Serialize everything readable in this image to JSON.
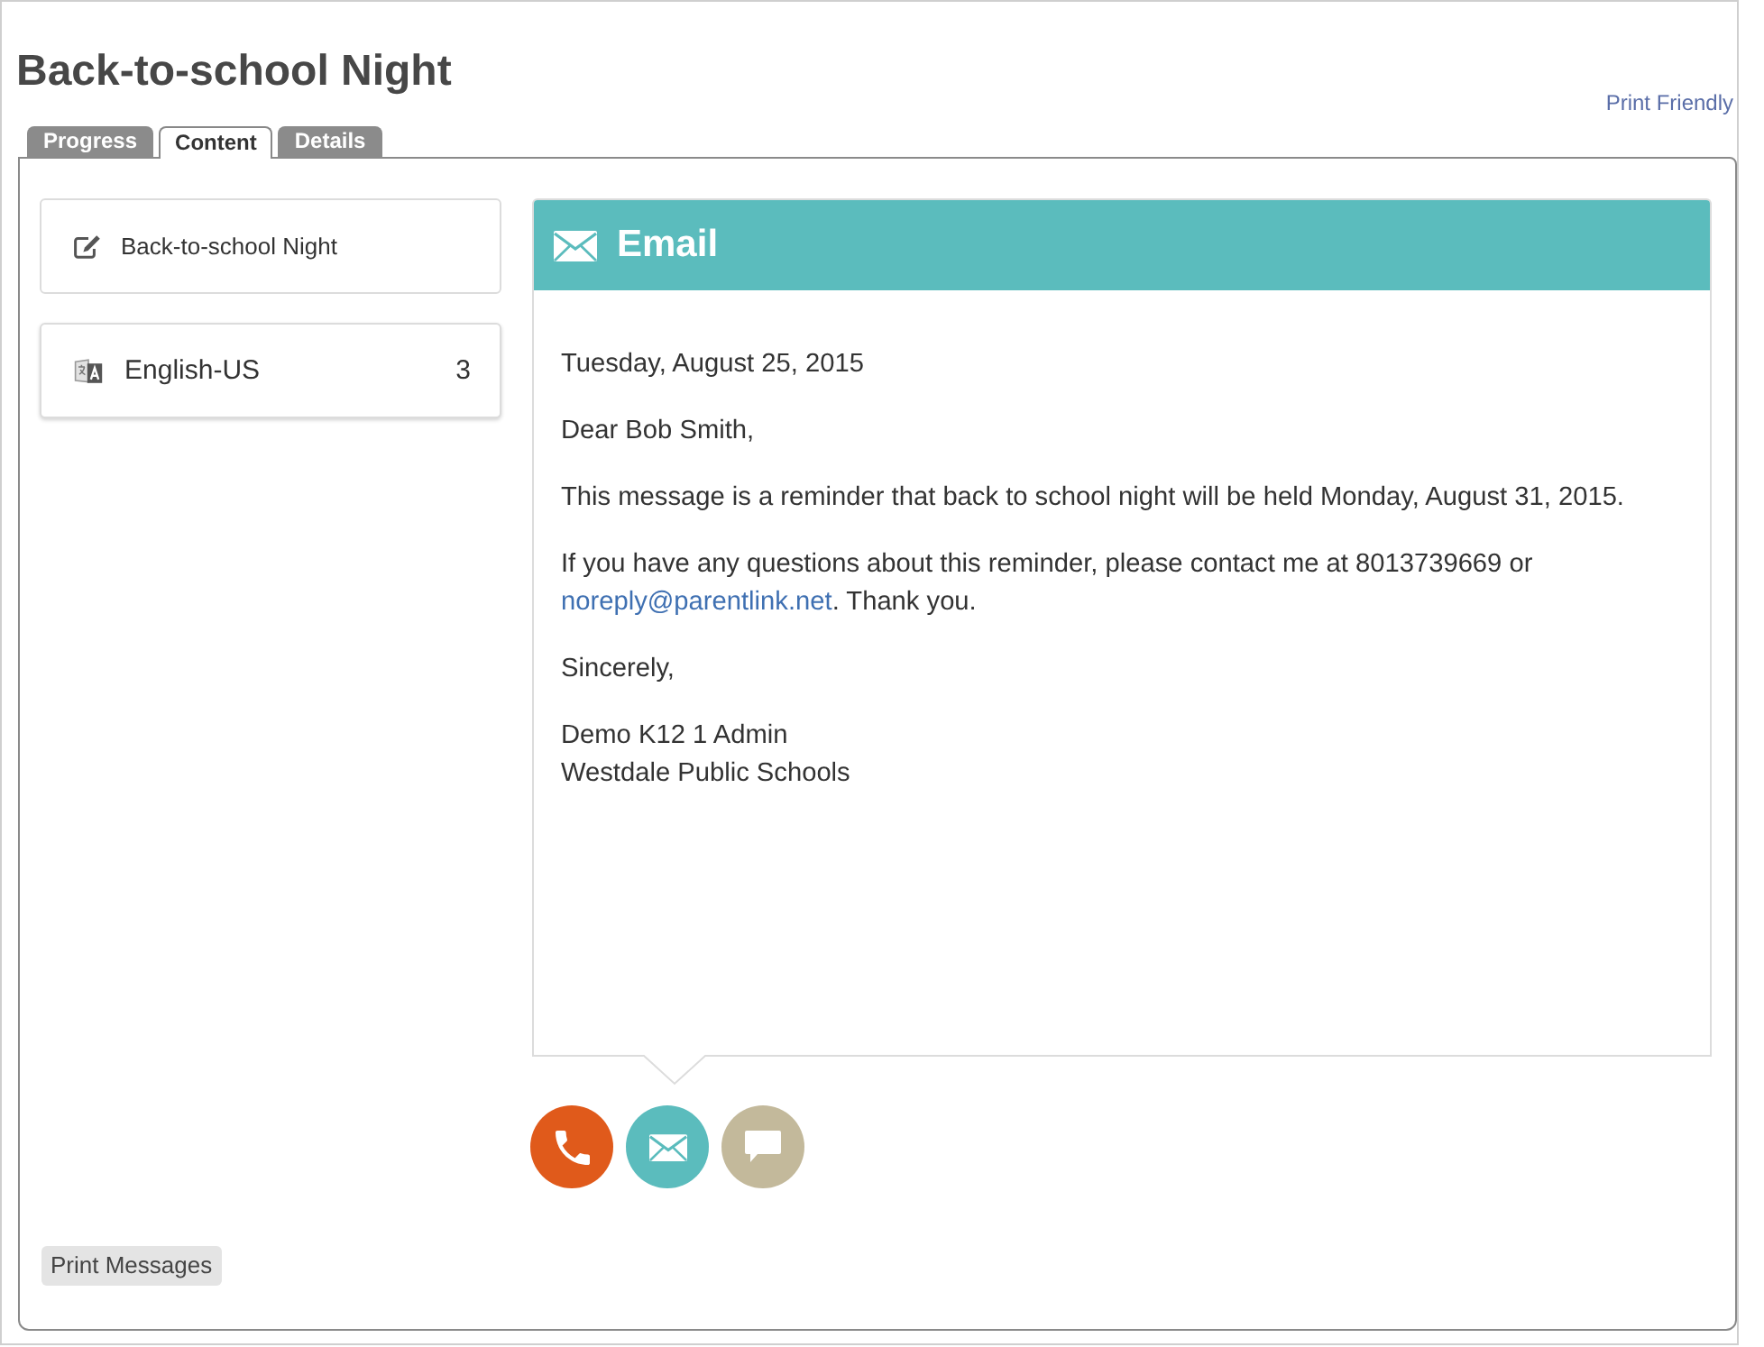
{
  "page": {
    "title": "Back-to-school Night",
    "print_link": "Print Friendly"
  },
  "tabs": [
    {
      "label": "Progress",
      "selected": false
    },
    {
      "label": "Content",
      "selected": true
    },
    {
      "label": "Details",
      "selected": false
    }
  ],
  "sidebar": {
    "items": [
      {
        "kind": "message",
        "label": "Back-to-school Night"
      },
      {
        "kind": "language",
        "label": "English-US",
        "count": "3"
      }
    ]
  },
  "message": {
    "kind": "email",
    "title": "Email",
    "body": [
      {
        "kind": "text",
        "text": "Tuesday, August 25, 2015"
      },
      {
        "kind": "text",
        "text": "Dear Bob Smith,"
      },
      {
        "kind": "text",
        "text": "This message is a reminder that back to school night will be held Monday, August 31, 2015."
      },
      {
        "kind": "link_text",
        "before": "If you have any questions about this reminder, please contact me at 8013739669 or ",
        "link": "noreply@parentlink.net",
        "after": ". Thank you."
      },
      {
        "kind": "text",
        "text": "Sincerely,"
      },
      {
        "kind": "lines",
        "lines": [
          "Demo K12 1 Admin",
          "Westdale Public Schools"
        ]
      }
    ]
  },
  "channels": [
    {
      "kind": "phone",
      "color": "#e05a1b",
      "selected": false
    },
    {
      "kind": "email",
      "color": "#5bbcbd",
      "selected": true
    },
    {
      "kind": "text_message",
      "color": "#c3b99b",
      "selected": false
    }
  ],
  "print_button": "Print Messages"
}
